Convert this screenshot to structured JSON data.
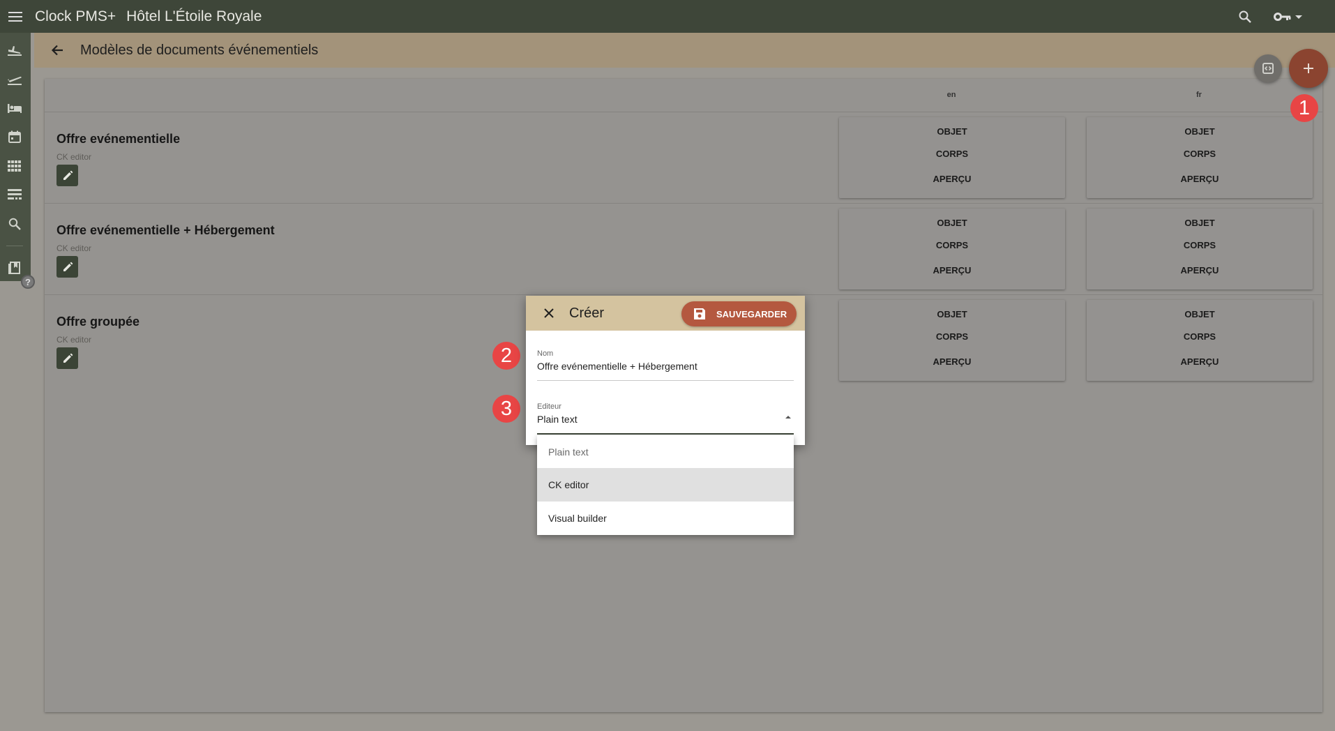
{
  "topbar": {
    "menu_icon": "menu-icon",
    "app_name": "Clock PMS+",
    "hotel_name": "Hôtel L'Étoile Royale",
    "search_icon": "search-icon",
    "key_icon": "key-icon"
  },
  "sidebar": {
    "items": [
      {
        "icon": "flight-land-icon"
      },
      {
        "icon": "flight-takeoff-icon"
      },
      {
        "icon": "hotel-bed-icon"
      },
      {
        "icon": "calendar-icon"
      },
      {
        "icon": "grid-icon"
      },
      {
        "icon": "table-rows-icon"
      },
      {
        "icon": "search-icon"
      },
      {
        "icon": "book-icon"
      }
    ],
    "help_label": "?"
  },
  "subheader": {
    "title": "Modèles de documents événementiels"
  },
  "table": {
    "columns": [
      "en",
      "fr"
    ],
    "rows": [
      {
        "name": "Offre evénementielle",
        "editor": "CK editor"
      },
      {
        "name": "Offre evénementielle + Hébergement",
        "editor": "CK editor"
      },
      {
        "name": "Offre groupée",
        "editor": "CK editor"
      }
    ],
    "card_labels": {
      "subject": "OBJET",
      "body": "CORPS",
      "preview": "APERÇU"
    }
  },
  "callouts": [
    "1",
    "2",
    "3"
  ],
  "dialog": {
    "title": "Créer",
    "save_label": "SAUVEGARDER",
    "name_label": "Nom",
    "name_value": "Offre evénementielle + Hébergement",
    "editor_label": "Editeur",
    "editor_value": "Plain text"
  },
  "dropdown": {
    "options": [
      "Plain text",
      "CK editor",
      "Visual builder"
    ],
    "selected": "Plain text",
    "highlighted": "CK editor"
  },
  "colors": {
    "topbar": "#3e4639",
    "subheader": "#a3937a",
    "dialog_header": "#d4c39f",
    "save_button": "#b4583f",
    "fab": "#8b4430",
    "callout": "#e84545"
  }
}
